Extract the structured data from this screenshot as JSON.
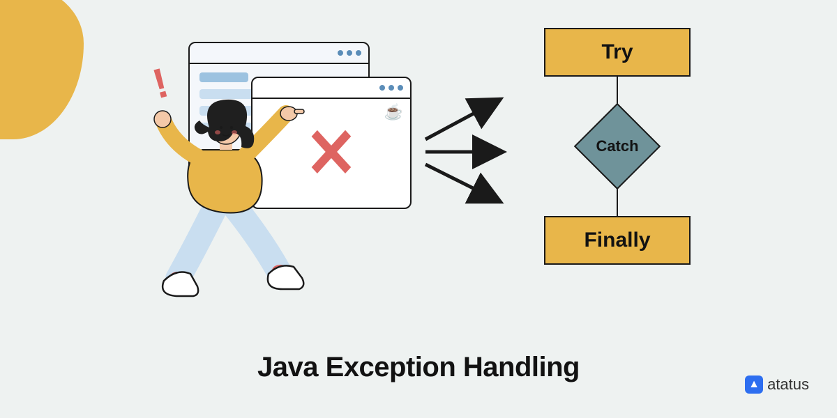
{
  "title": "Java Exception Handling",
  "flow": {
    "try": "Try",
    "catch": "Catch",
    "finally": "Finally"
  },
  "brand": {
    "name": "atatus",
    "icon_glyph": "▲"
  },
  "icons": {
    "error_x": "✕",
    "exclaim": "!",
    "java_cup": "☕"
  },
  "colors": {
    "background": "#eef2f1",
    "accent_yellow": "#e8b64a",
    "accent_red": "#de6461",
    "accent_teal": "#6f939a",
    "brand_blue": "#2d6ef0",
    "stroke": "#1a1a1a"
  }
}
